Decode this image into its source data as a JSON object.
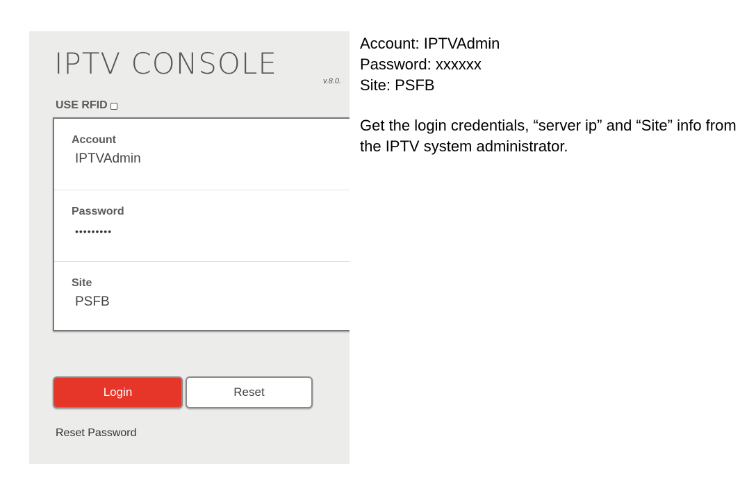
{
  "console": {
    "title": "IPTV CONSOLE",
    "version": "v.8.0.",
    "rfid_label": "USE RFID",
    "fields": [
      {
        "label": "Account",
        "value": "IPTVAdmin"
      },
      {
        "label": "Password",
        "value": "•••••••••"
      },
      {
        "label": "Site",
        "value": "PSFB"
      }
    ],
    "login_label": "Login",
    "reset_label": "Reset",
    "reset_password_label": "Reset Password"
  },
  "notes": {
    "account_line": "Account: IPTVAdmin",
    "password_line": "Password: xxxxxx",
    "site_line": "Site: PSFB",
    "instructions": "Get the login credentials,  “server ip” and “Site” info from the IPTV system administrator."
  },
  "colors": {
    "panel_bg": "#ececeb",
    "login_button": "#e53629"
  }
}
